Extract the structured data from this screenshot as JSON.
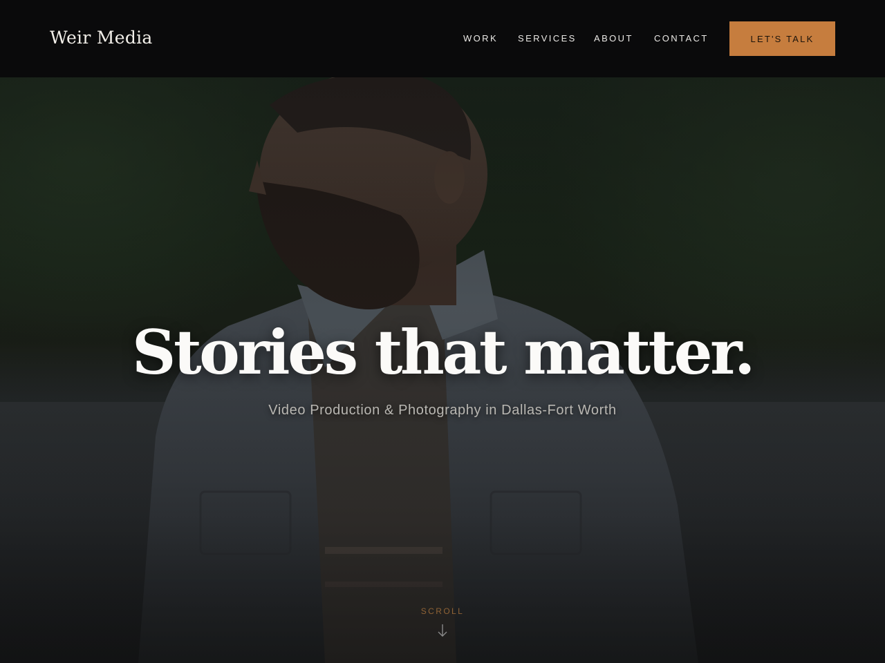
{
  "header": {
    "brand": "Weir Media",
    "nav": [
      {
        "label": "WORK"
      },
      {
        "label": "SERVICES"
      },
      {
        "label": "ABOUT"
      },
      {
        "label": "CONTACT"
      }
    ],
    "cta_label": "LET'S TALK"
  },
  "hero": {
    "headline": "Stories that matter.",
    "subheadline": "Video Production & Photography in Dallas-Fort Worth",
    "scroll_label": "SCROLL",
    "scroll_icon": "arrow-down-icon"
  },
  "colors": {
    "accent": "#c67d3e",
    "header_bg": "#0a0a0b",
    "scroll_text": "#8f6236"
  }
}
